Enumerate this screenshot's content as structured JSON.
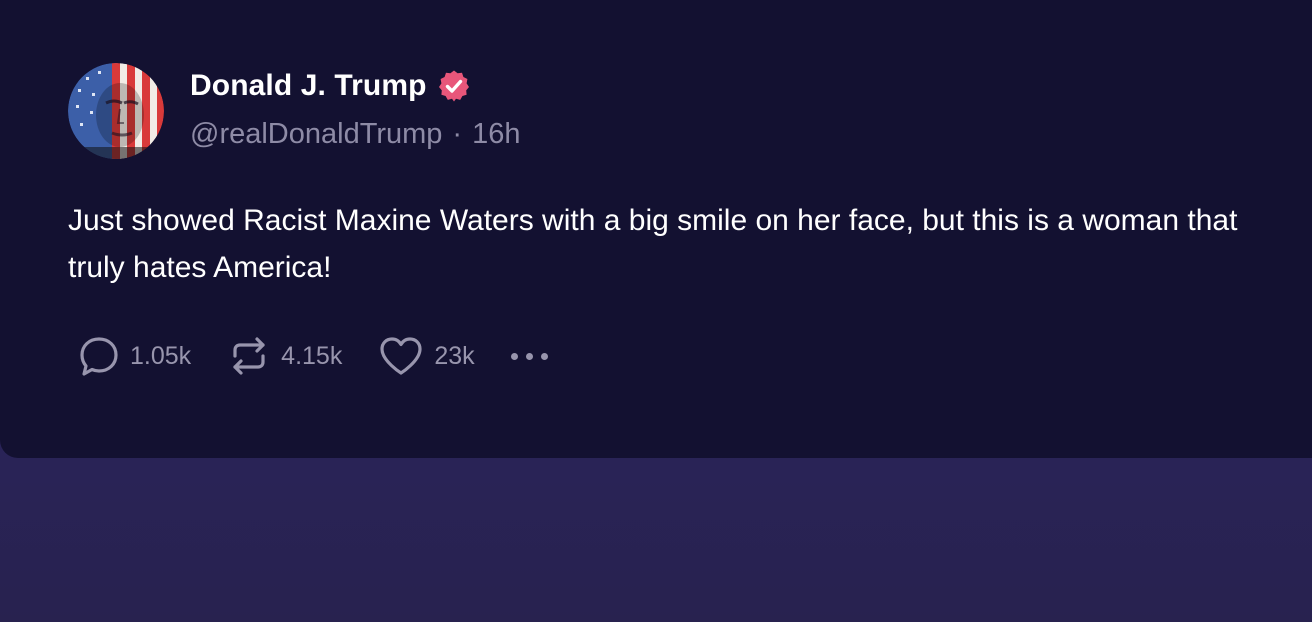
{
  "post": {
    "author": {
      "display_name": "Donald J. Trump",
      "handle": "@realDonaldTrump",
      "separator": "·",
      "time": "16h",
      "verified": true,
      "avatar_icon": "flag-portrait-avatar",
      "verified_icon": "verified-badge-icon"
    },
    "text": "Just showed Racist Maxine Waters with a big smile on her face, but this is a woman that truly hates America!",
    "actions": {
      "replies": "1.05k",
      "reposts": "4.15k",
      "likes": "23k",
      "reply_icon": "reply-icon",
      "repost_icon": "repost-icon",
      "like_icon": "heart-icon",
      "more_icon": "more-options-icon"
    }
  },
  "colors": {
    "card_background": "#131131",
    "page_background": "#2a245c",
    "verified_badge": "#e8567a",
    "secondary_text": "#8e8ba6"
  }
}
